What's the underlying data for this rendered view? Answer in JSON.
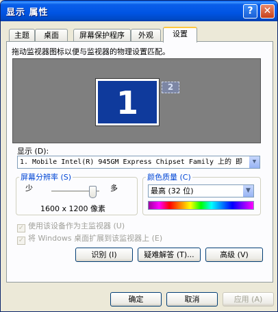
{
  "window": {
    "title": "显示 属性",
    "help_glyph": "?",
    "close_glyph": "✕"
  },
  "tabs": [
    {
      "label": "主题"
    },
    {
      "label": "桌面"
    },
    {
      "label": "屏幕保护程序"
    },
    {
      "label": "外观"
    },
    {
      "label": "设置",
      "active": true
    }
  ],
  "settings": {
    "instruction": "拖动监视器图标以便与监视器的物理设置匹配。",
    "monitors": [
      {
        "number": "1"
      },
      {
        "number": "2"
      }
    ],
    "display_label": "显示 (D):",
    "display_value": "1. Mobile Intel(R) 945GM Express Chipset Family 上的 即",
    "resolution": {
      "legend": "屏幕分辨率 (S)",
      "low_label": "少",
      "high_label": "多",
      "value_text": "1600 x 1200 像素",
      "slider_level": 0.8
    },
    "color_quality": {
      "legend": "颜色质量 (C)",
      "selected": "最高 (32 位)"
    },
    "checkboxes": [
      {
        "label": "使用该设备作为主监视器 (U)",
        "checked": true,
        "enabled": false
      },
      {
        "label": "将 Windows 桌面扩展到该监视器上 (E)",
        "checked": true,
        "enabled": false
      }
    ],
    "buttons": {
      "identify": "识别 (I)",
      "troubleshoot": "疑难解答 (T)...",
      "advanced": "高级 (V)"
    }
  },
  "footer": {
    "ok": "确定",
    "cancel": "取消",
    "apply": "应用 (A)"
  },
  "colors": {
    "title_bar": "#0054e3",
    "accent_tab": "#ffc73c",
    "monitor_primary": "#0f3a9c",
    "group_legend": "#0046d5"
  }
}
